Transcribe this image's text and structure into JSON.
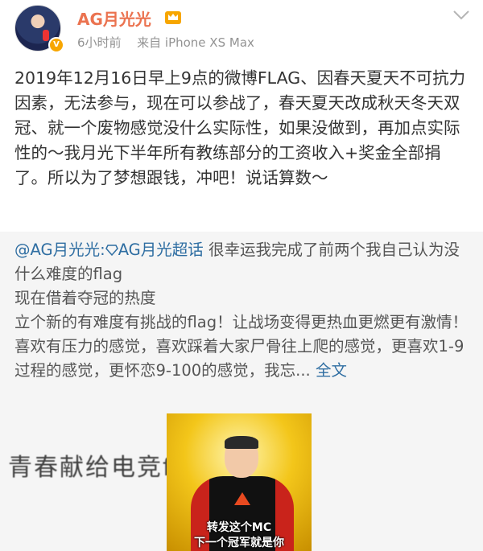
{
  "header": {
    "username": "AG月光光",
    "time": "6小时前",
    "source_prefix": "来自",
    "source": "iPhone XS Max",
    "verified_badge": "V",
    "icons": {
      "member": "crown-icon",
      "verified": "verified-badge-icon",
      "menu": "chevron-down-icon"
    },
    "colors": {
      "username": "#eb7350",
      "member_crown": "#f7a600",
      "link": "#2f6ea2"
    }
  },
  "post": {
    "text": "2019年12月16日早上9点的微博FLAG、因春天夏天不可抗力因素，无法参与，现在可以参战了，春天夏天改成秋天冬天双冠、就一个废物感觉没什么实际性，如果没做到，再加点实际性的～我月光下半年所有教练部分的工资收入+奖金全部捐了。所以为了梦想跟钱，冲吧！说话算数～"
  },
  "repost": {
    "author_link": "@AG月光光",
    "separator": ":",
    "super_topic": "AG月光超话",
    "line1": " 很幸运我完成了前两个我自己认为没什么难度的flag",
    "line2": "现在借着夺冠的热度",
    "line3": "立个新的有难度有挑战的flag！让战场变得更热血更燃更有激情！",
    "line4": "喜欢有压力的感觉，喜欢踩着大家尸骨往上爬的感觉，更喜欢1-9过程的感觉，更怀恋9-100的感觉，我忘...",
    "full_text_link": "全文",
    "image": {
      "caption_line1": "转发这个MC",
      "caption_line2": "下一个冠军就是你"
    },
    "side_text": "青春献给电竞f"
  }
}
